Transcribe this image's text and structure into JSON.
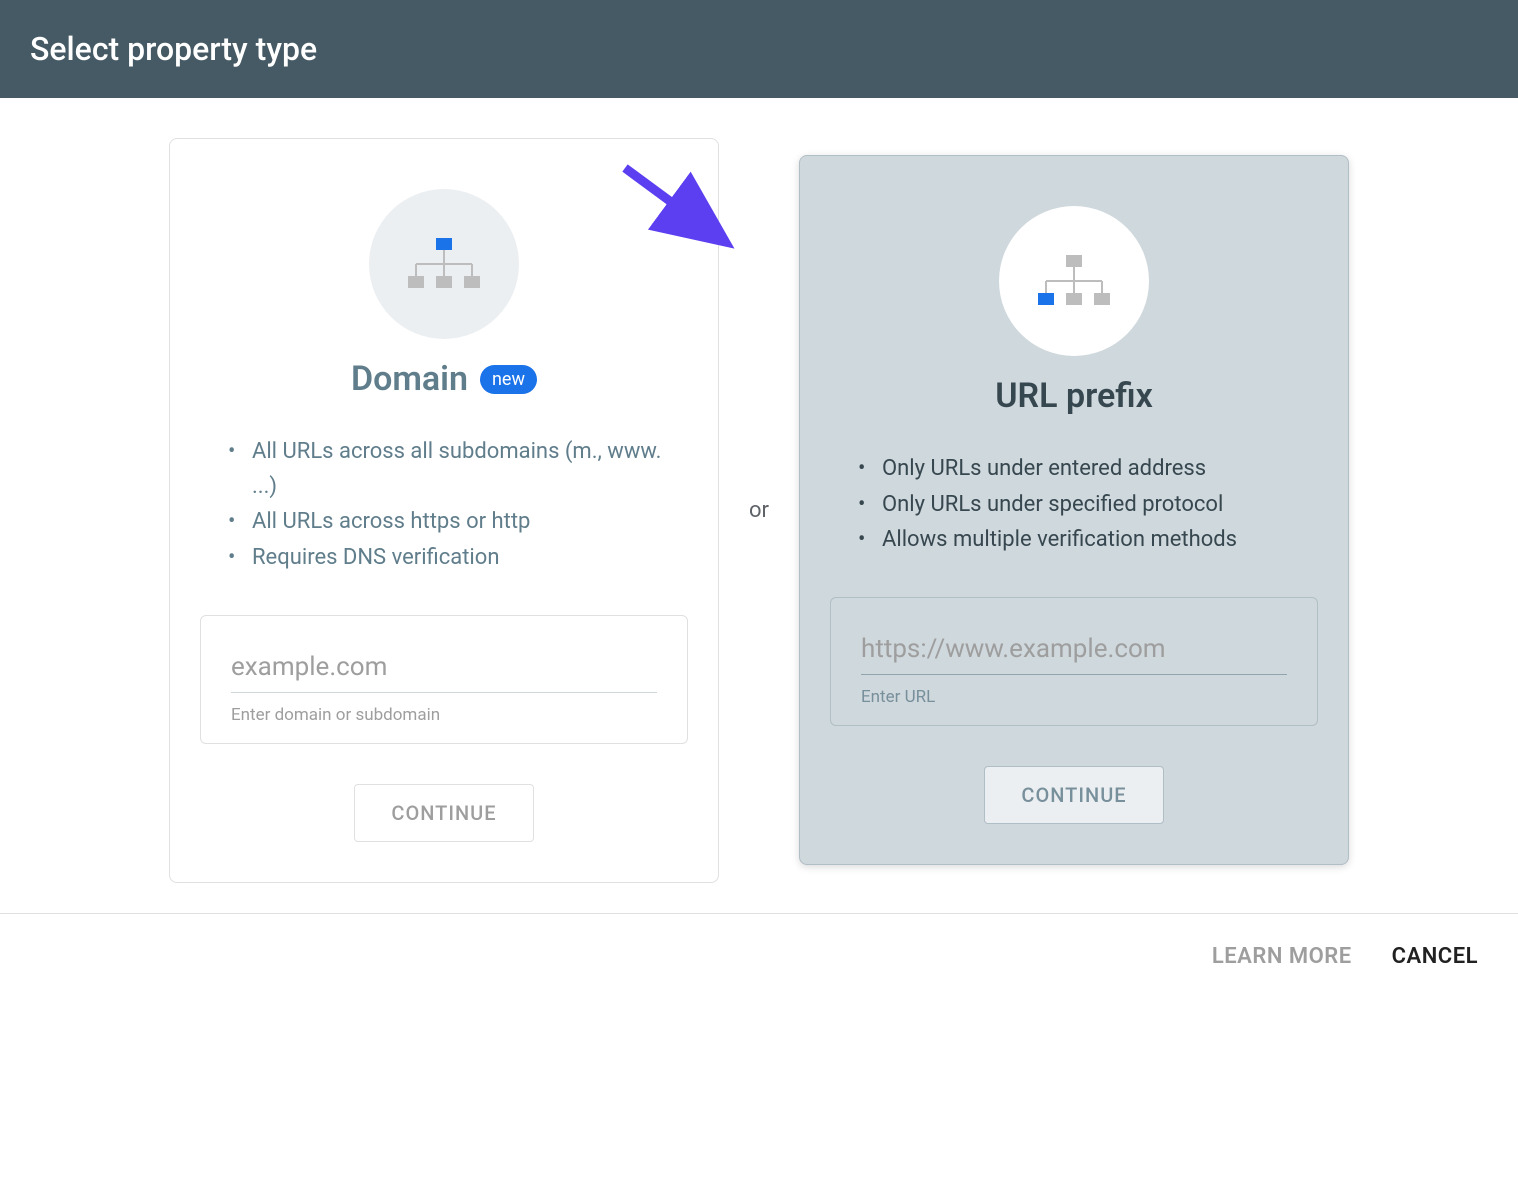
{
  "header": {
    "title": "Select property type"
  },
  "separator": "or",
  "cards": {
    "domain": {
      "title": "Domain",
      "badge": "new",
      "features": [
        "All URLs across all subdomains (m., www. ...)",
        "All URLs across https or http",
        "Requires DNS verification"
      ],
      "placeholder": "example.com",
      "hint": "Enter domain or subdomain",
      "button": "CONTINUE"
    },
    "urlprefix": {
      "title": "URL prefix",
      "features": [
        "Only URLs under entered address",
        "Only URLs under specified protocol",
        "Allows multiple verification methods"
      ],
      "placeholder": "https://www.example.com",
      "hint": "Enter URL",
      "button": "CONTINUE"
    }
  },
  "footer": {
    "learn": "LEARN MORE",
    "cancel": "CANCEL"
  }
}
